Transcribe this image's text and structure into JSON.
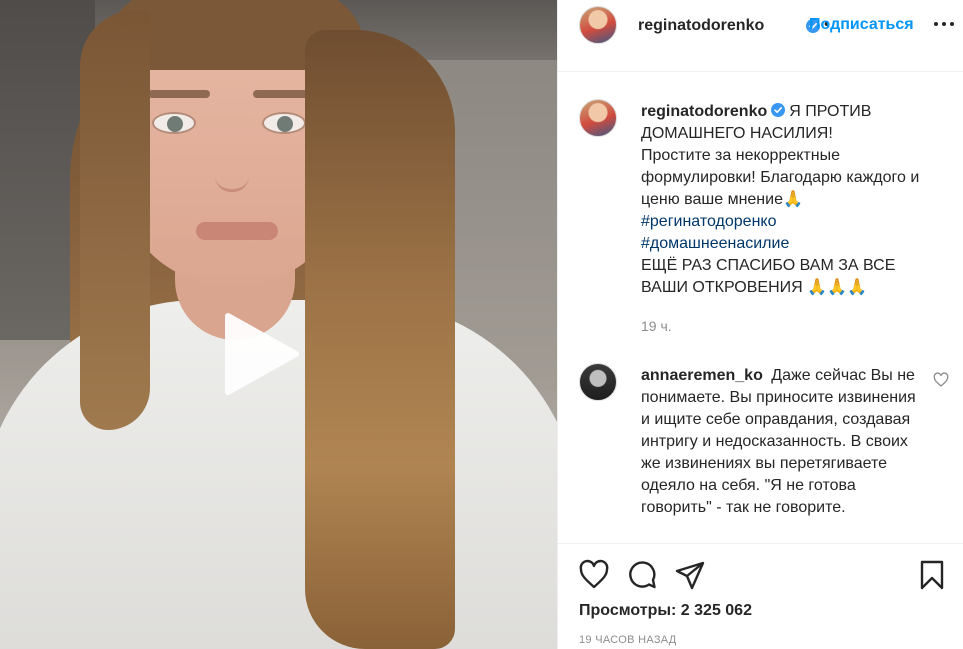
{
  "header": {
    "username": "reginatodorenko",
    "follow_label": "Подписаться"
  },
  "caption": {
    "username": "reginatodorenko",
    "line1": "Я ПРОТИВ ДОМАШНЕГО НАСИЛИЯ!",
    "line2": "Простите за некорректные формулировки! Благодарю каждого и ценю ваше мнение🙏",
    "hashtag1": "#регинатодоренко",
    "hashtag2": "#домашнеенасилие",
    "line3": "ЕЩЁ РАЗ СПАСИБО ВАМ ЗА ВСЕ ВАШИ ОТКРОВЕНИЯ 🙏🙏🙏",
    "time": "19 ч."
  },
  "comment": {
    "username": "annaeremen_ko",
    "text": "Даже сейчас Вы не понимаете. Вы приносите извинения и ищите себе оправдания, создавая интригу и недосказанность. В своих же извинениях вы перетягиваете одеяло на себя. \"Я не готова говорить\" - так не говорите."
  },
  "stats": {
    "views_label": "Просмотры:",
    "views_value": "2 325 062",
    "date": "19 ЧАСОВ НАЗАД"
  },
  "icons": {
    "play": "play-icon",
    "verified": "verified-badge-icon",
    "more": "more-options-icon",
    "like": "heart-icon",
    "comment": "comment-icon",
    "share": "share-icon",
    "save": "bookmark-icon"
  },
  "colors": {
    "accent": "#0095f6",
    "hashtag": "#00376b",
    "muted": "#8e8e8e",
    "text": "#262626"
  }
}
